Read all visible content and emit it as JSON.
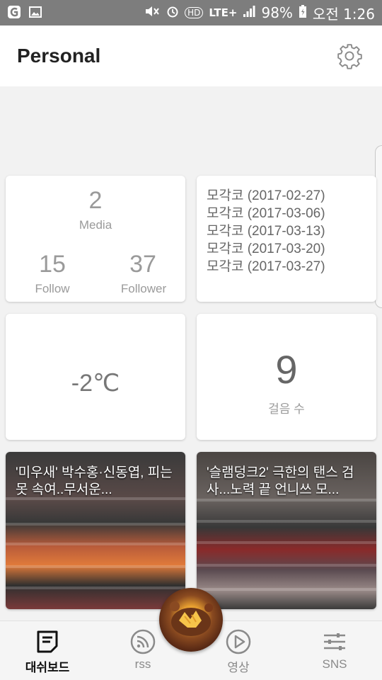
{
  "status_bar": {
    "battery": "98%",
    "time": "오전 1:26",
    "network": "LTE+",
    "hd": "HD"
  },
  "app_bar": {
    "title": "Personal"
  },
  "media_card": {
    "media_count": "2",
    "media_label": "Media",
    "follow_count": "15",
    "follow_label": "Follow",
    "follower_count": "37",
    "follower_label": "Follower"
  },
  "events": [
    "모각코 (2017-02-27)",
    "모각코 (2017-03-06)",
    "모각코 (2017-03-13)",
    "모각코 (2017-03-20)",
    "모각코 (2017-03-27)"
  ],
  "weather": {
    "temperature": "-2℃"
  },
  "steps": {
    "count": "9",
    "label": "걸음 수"
  },
  "news": [
    {
      "title": "'미우새' 박수홍·신동엽, 피는 못 속여..무서운..."
    },
    {
      "title": "'슬램덩크2' 극한의 탠스 검사...노력 끝 언니쓰 모..."
    }
  ],
  "bottom_nav": {
    "items": [
      {
        "label": "대쉬보드",
        "icon": "dashboard-icon",
        "active": true
      },
      {
        "label": "rss",
        "icon": "rss-icon",
        "active": false
      },
      {
        "label": "영상",
        "icon": "play-icon",
        "active": false
      },
      {
        "label": "SNS",
        "icon": "sliders-icon",
        "active": false
      }
    ]
  },
  "colors": {
    "status_bar": "#7d7d7d",
    "background": "#f2f2f2",
    "card": "#ffffff",
    "muted_text": "#9a9a9a"
  }
}
